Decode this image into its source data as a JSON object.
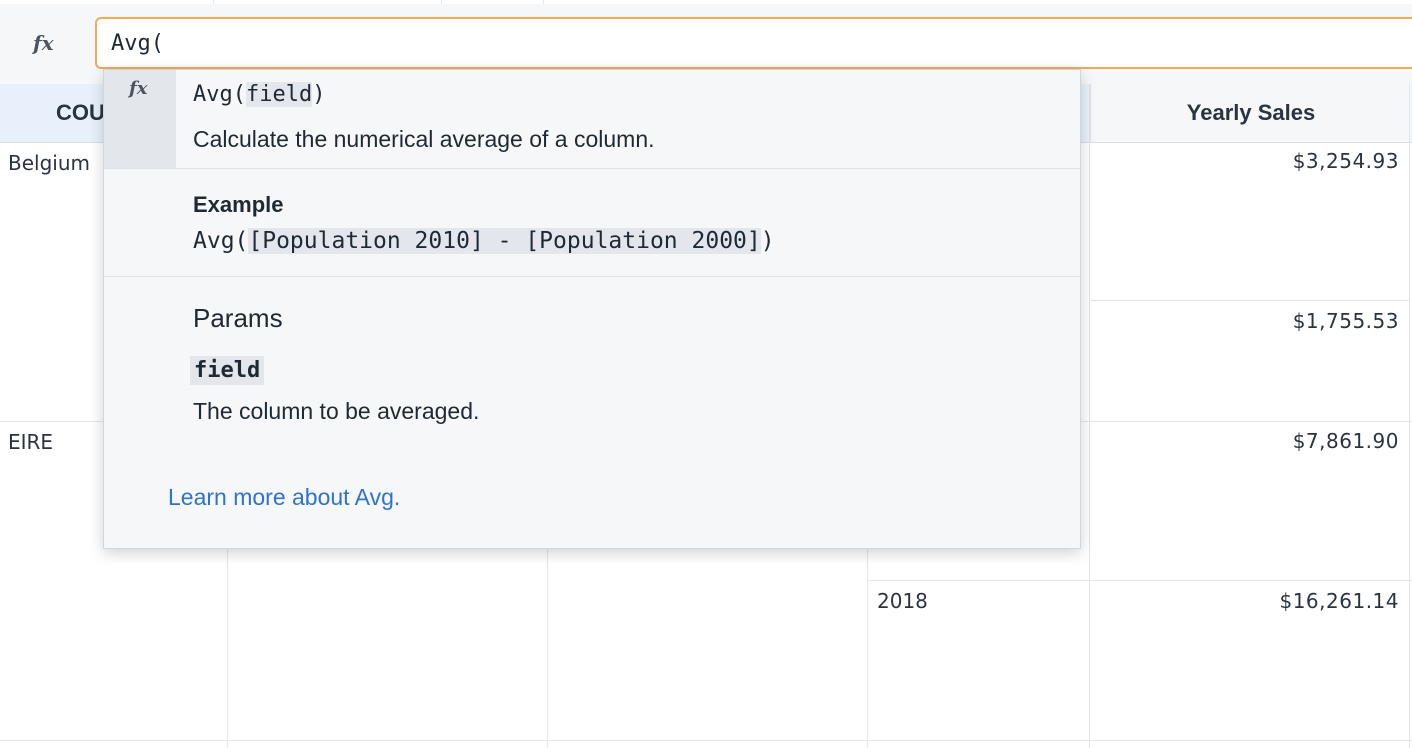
{
  "formula_bar": {
    "fx_label": "fx",
    "input_value": "Avg("
  },
  "table": {
    "headers": {
      "country": "COU",
      "sales": "Yearly Sales"
    },
    "rows": [
      {
        "country": "Belgium",
        "year": "",
        "sales": "$3,254.93"
      },
      {
        "country": "",
        "year": "",
        "sales": "$1,755.53"
      },
      {
        "country": "EIRE",
        "year": "",
        "sales": "$7,861.90"
      },
      {
        "country": "",
        "year": "2018",
        "sales": "$16,261.14"
      }
    ]
  },
  "autocomplete": {
    "fx_label": "fx",
    "function_name": "Avg(",
    "param": "field",
    "close": ")",
    "description": "Calculate the numerical average of a column.",
    "example_title": "Example",
    "example_prefix": "Avg(",
    "example_arg": "[Population 2010] - [Population 2000]",
    "example_suffix": ")",
    "params_title": "Params",
    "param_name": "field",
    "param_description": "The column to be averaged.",
    "learn_more": "Learn more about Avg."
  },
  "colors": {
    "focus_border": "#f5a855",
    "link": "#2f73d0",
    "header_bg": "#e8f1fb"
  }
}
